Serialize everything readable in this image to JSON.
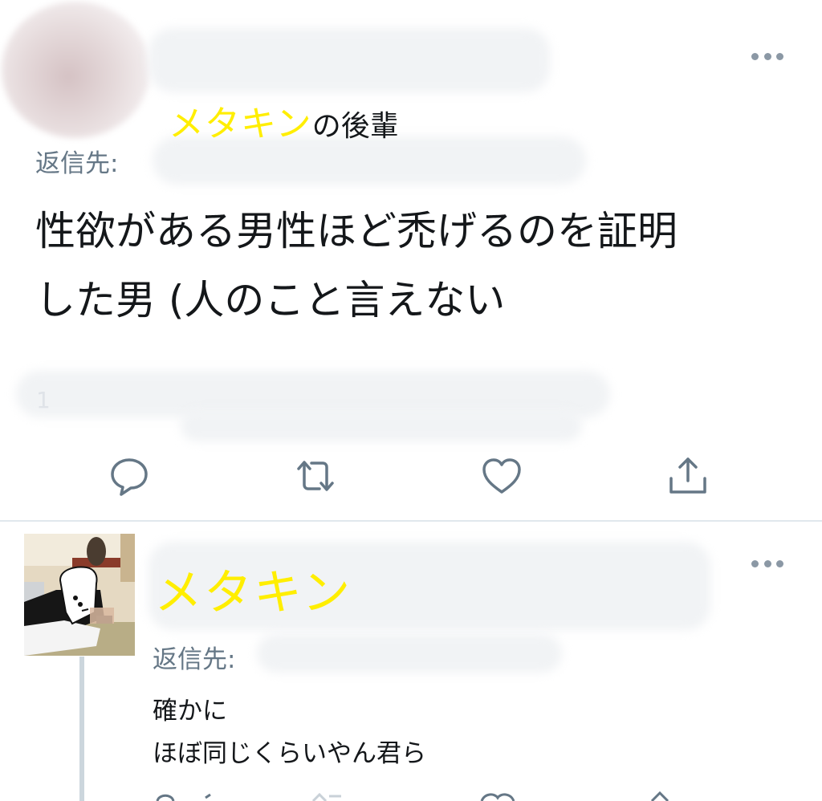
{
  "tweet1": {
    "name_highlight": "メタキン",
    "name_suffix": "の後輩",
    "reply_to_label": "返信先:",
    "text": "性欲がある男性ほど禿げるのを証明\nした男 (人のこと言えない",
    "timestamp_visible_char": "1",
    "actions": [
      "reply-icon",
      "retweet-icon",
      "like-icon",
      "share-icon"
    ]
  },
  "tweet2": {
    "name": "メタキン",
    "reply_to_label": "返信先:",
    "text": "確かに\nほぼ同じくらいやん君ら"
  },
  "colors": {
    "name_highlight": "#ffee00",
    "text": "#14171a",
    "secondary": "#657786",
    "icon": "#657786",
    "divider": "#e1e8ed"
  }
}
